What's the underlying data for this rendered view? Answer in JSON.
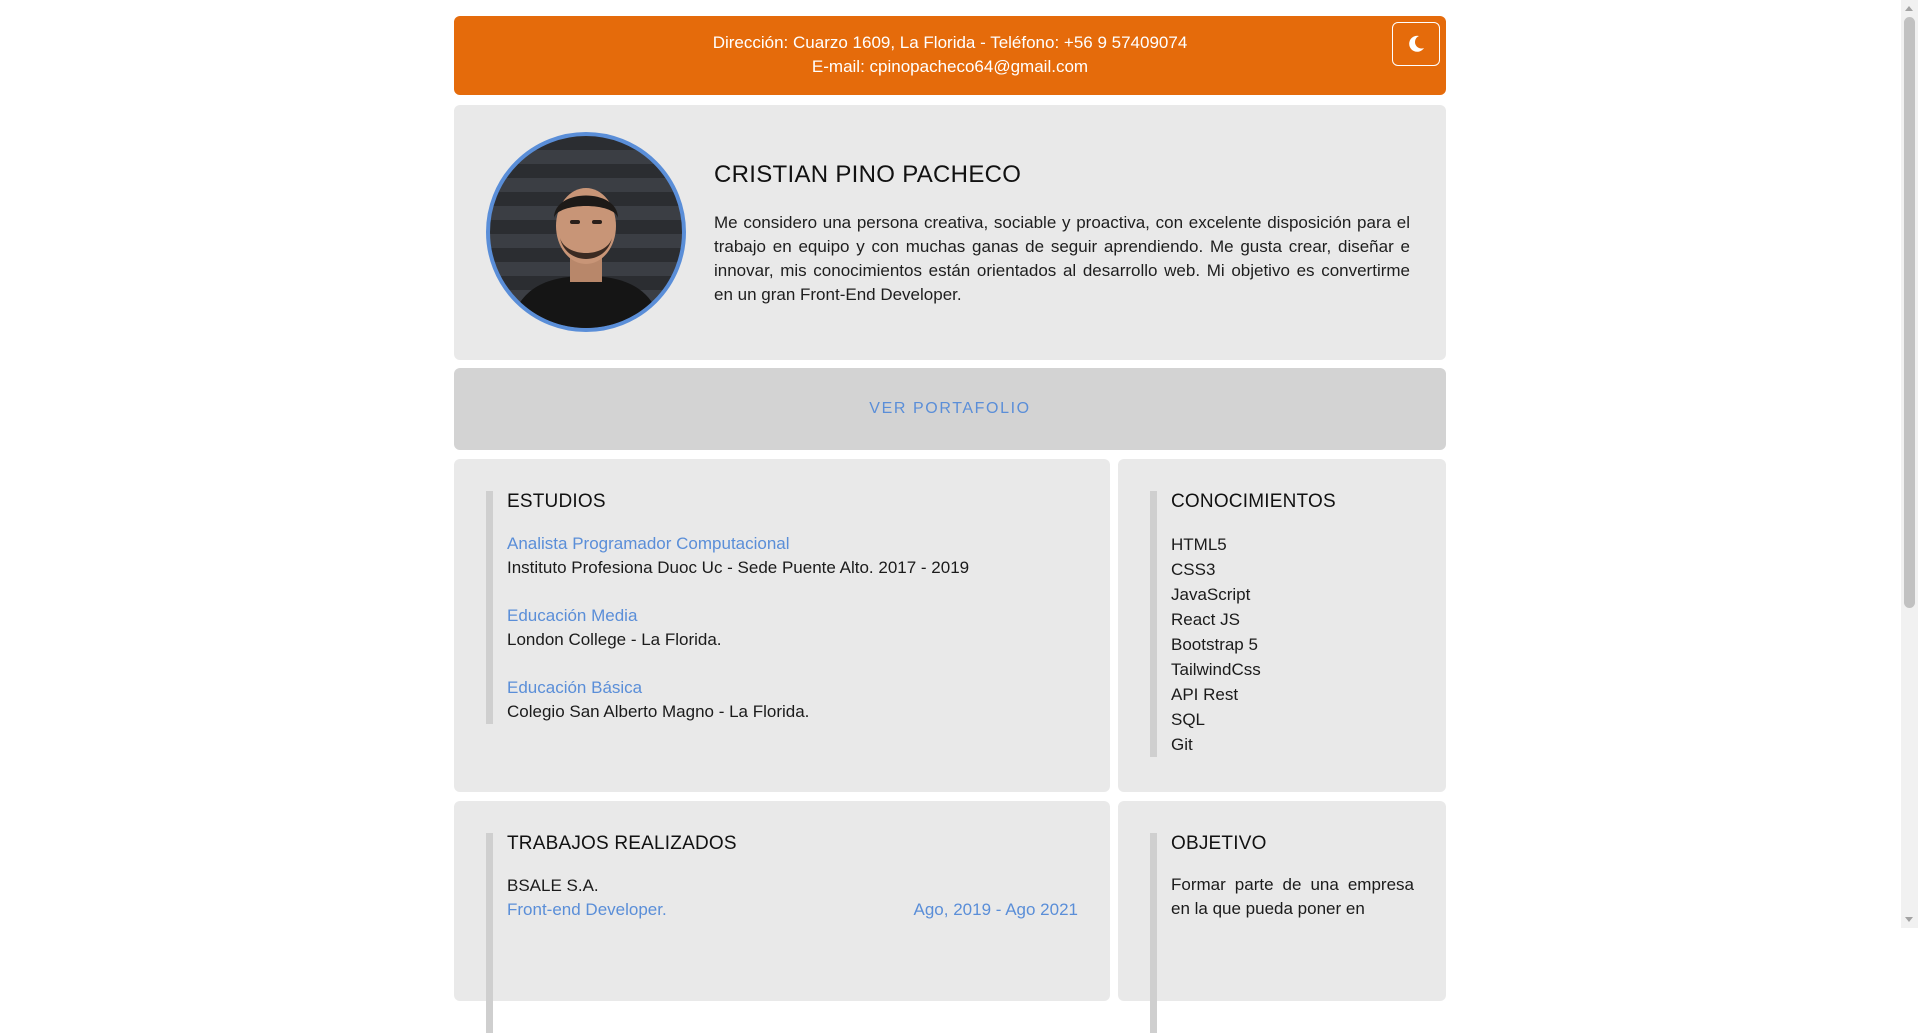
{
  "contact": {
    "line1": "Dirección: Cuarzo 1609, La Florida - Teléfono: +56 9 57409074",
    "line2": "E-mail: cpinopacheco64@gmail.com"
  },
  "profile": {
    "name": "CRISTIAN PINO PACHECO",
    "bio": "Me considero una persona creativa, sociable y proactiva, con excelente disposición para el trabajo en equipo y con muchas ganas de seguir aprendiendo. Me gusta crear, diseñar e innovar, mis conocimientos están orientados al desarrollo web. Mi objetivo es convertirme en un gran Front-End Developer."
  },
  "portfolio": {
    "label": "VER PORTAFOLIO"
  },
  "studies": {
    "title": "ESTUDIOS",
    "items": [
      {
        "degree": "Analista Programador Computacional",
        "place": "Instituto Profesiona Duoc Uc - Sede Puente Alto. 2017 - 2019"
      },
      {
        "degree": "Educación Media",
        "place": "London College - La Florida."
      },
      {
        "degree": "Educación Básica",
        "place": "Colegio San Alberto Magno - La Florida."
      }
    ]
  },
  "skills": {
    "title": "CONOCIMIENTOS",
    "items": [
      "HTML5",
      "CSS3",
      "JavaScript",
      "React JS",
      "Bootstrap 5",
      "TailwindCss",
      "API Rest",
      "SQL",
      "Git"
    ]
  },
  "jobs": {
    "title": "TRABAJOS REALIZADOS",
    "items": [
      {
        "company": "BSALE S.A.",
        "role": "Front-end Developer.",
        "period": "Ago, 2019 - Ago 2021"
      }
    ]
  },
  "objective": {
    "title": "OBJETIVO",
    "text": "Formar parte de una empresa en la que pueda poner en"
  },
  "colors": {
    "accent": "#e56b0b",
    "link": "#5a8ed8",
    "card": "#e9e9e9"
  }
}
